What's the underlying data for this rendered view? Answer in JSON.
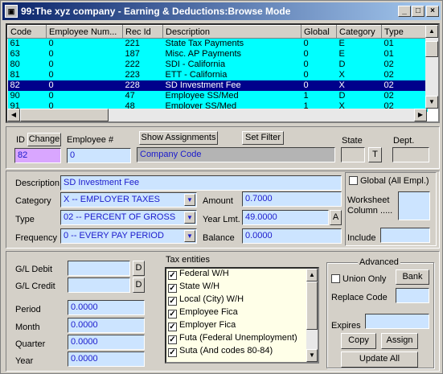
{
  "title": "99:The xyz company - Earning & Deductions:Browse Mode",
  "title_icon": "app-icon",
  "grid": {
    "headers": [
      "Code",
      "Employee Num...",
      "Rec Id",
      "Description",
      "Global",
      "Category",
      "Type"
    ],
    "rows": [
      [
        "61",
        "0",
        "221",
        "State Tax Payments",
        "0",
        "E",
        "01"
      ],
      [
        "63",
        "0",
        "187",
        "Misc. AP Payments",
        "0",
        "E",
        "01"
      ],
      [
        "80",
        "0",
        "222",
        "SDI - California",
        "0",
        "D",
        "02"
      ],
      [
        "81",
        "0",
        "223",
        "ETT - California",
        "0",
        "X",
        "02"
      ],
      [
        "82",
        "0",
        "228",
        "SD Investment Fee",
        "0",
        "X",
        "02"
      ],
      [
        "90",
        "0",
        "47",
        "Employee SS/Med",
        "1",
        "D",
        "02"
      ],
      [
        "91",
        "0",
        "48",
        "Employer SS/Med",
        "1",
        "X",
        "02"
      ]
    ],
    "selected_row": 4
  },
  "top": {
    "id_label": "ID",
    "change_label": "Change",
    "id_value": "82",
    "employee_label": "Employee #",
    "employee_value": "0",
    "show_assignments_label": "Show Assignments",
    "set_filter_label": "Set Filter",
    "company_code_value": "Company Code",
    "state_label": "State",
    "state_button": "T",
    "dept_label": "Dept."
  },
  "details": {
    "description_label": "Description",
    "description_value": "SD Investment Fee",
    "category_label": "Category",
    "category_value": "X -- EMPLOYER TAXES",
    "type_label": "Type",
    "type_value": "02 -- PERCENT OF GROSS",
    "frequency_label": "Frequency",
    "frequency_value": "0 -- EVERY PAY PERIOD",
    "amount_label": "Amount",
    "amount_value": "0.7000",
    "year_lmt_label": "Year Lmt.",
    "year_lmt_value": "49.0000",
    "year_lmt_button": "A",
    "balance_label": "Balance",
    "balance_value": "0.0000",
    "global_label": "Global (All Empl.)",
    "worksheet_label": "Worksheet Column .....",
    "include_label": "Include"
  },
  "bottom": {
    "gl_debit_label": "G/L Debit",
    "gl_credit_label": "G/L Credit",
    "d_button": "D",
    "period_label": "Period",
    "period_value": "0.0000",
    "month_label": "Month",
    "month_value": "0.0000",
    "quarter_label": "Quarter",
    "quarter_value": "0.0000",
    "year_label": "Year",
    "year_value": "0.0000",
    "tax_entities_label": "Tax entities",
    "tax_entities": [
      "Federal W/H",
      "State W/H",
      "Local (City) W/H",
      "Employee Fica",
      "Employer Fica",
      "Futa (Federal Unemployment)",
      "Suta (And codes 80-84)"
    ],
    "advanced_label": "Advanced",
    "union_only_label": "Union Only",
    "bank_label": "Bank",
    "replace_code_label": "Replace Code",
    "expires_label": "Expires",
    "copy_label": "Copy",
    "assign_label": "Assign",
    "update_all_label": "Update All"
  }
}
